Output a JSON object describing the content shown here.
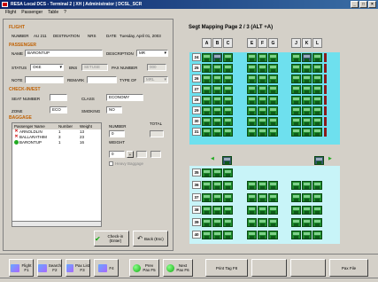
{
  "window": {
    "title": "RESA Local DCS - Terminal 2 | XH | Administrator | DCSL_SCR"
  },
  "menu": [
    "Flight",
    "Passenger",
    "Table",
    "?"
  ],
  "flight": {
    "section": "FLIGHT",
    "number_label": "NUMBER",
    "number": "AU 211",
    "destination_label": "DESTINATION",
    "destination": "NRS",
    "date_label": "DATE",
    "date": "Tuesday, April 01, 2003"
  },
  "passenger": {
    "section": "PASSENGER",
    "name_label": "NAME",
    "name": "BARONTUP",
    "description_label": "DESCRIPTION",
    "description": "MR",
    "status_label": "STATUS",
    "status": "OKE",
    "bns_label": "BNS",
    "bns": "SETUSE",
    "pax_number_label": "PAX NUMBER",
    "pax_number": "000",
    "note_label": "NOTE",
    "remark_label": "REMARK",
    "type_of_label": "TYPE OF",
    "type_of": "MRL"
  },
  "check_in": {
    "section": "CHECK-IN/EST",
    "seat_label": "SEAT NUMBER",
    "class_label": "CLASS",
    "class": "ECONOMY",
    "zone_label": "ZONE",
    "zone": "ECO",
    "smoking_label": "SMOKING",
    "smoking": "NO"
  },
  "baggage": {
    "section": "BAGGAGE",
    "columns": [
      "Passenger Name",
      "Number",
      "Weight"
    ],
    "rows": [
      {
        "name": "ARNOLDLIN",
        "number": "1",
        "weight": "13",
        "status": "x"
      },
      {
        "name": "BALLARATHIM",
        "number": "3",
        "weight": "23",
        "status": "x"
      },
      {
        "name": "BARONTUP",
        "number": "1",
        "weight": "16",
        "status": "ok"
      }
    ],
    "number_label": "NUMBER",
    "number": "0",
    "weight_label": "WEIGHT",
    "weight": "0",
    "total_label": "TOTAL",
    "heavy_label": "Heavy Baggage"
  },
  "actions": {
    "checkin": "Check-in (Enter)",
    "back": "Back (Esc)"
  },
  "seatmap": {
    "title": "Segt Mapping Page 2 / 3 (ALT +A)",
    "columns": [
      "A",
      "B",
      "C",
      "",
      "E",
      "F",
      "G",
      "",
      "J",
      "K",
      "L"
    ],
    "upper_rows": [
      "24",
      "25",
      "26",
      "27",
      "28",
      "29",
      "30",
      "31"
    ],
    "lower_rows": [
      "35",
      "36",
      "37",
      "38",
      "39",
      "40"
    ]
  },
  "toolbar": [
    {
      "label": "Flight\nF1"
    },
    {
      "label": "Search\nF2"
    },
    {
      "label": "Pax List\nF3"
    },
    {
      "label": "F4"
    },
    {
      "label": "Prev\nPax F5"
    },
    {
      "label": "Next\nPax F6"
    },
    {
      "label": "Print Tag F8"
    },
    {
      "label": ""
    },
    {
      "label": ""
    },
    {
      "label": "Pax File"
    }
  ],
  "colors": {
    "cabin": "#6ee0ee",
    "seat": "#1c8a2a",
    "title_bar": "#0a246a",
    "section_label": "#c06000"
  }
}
